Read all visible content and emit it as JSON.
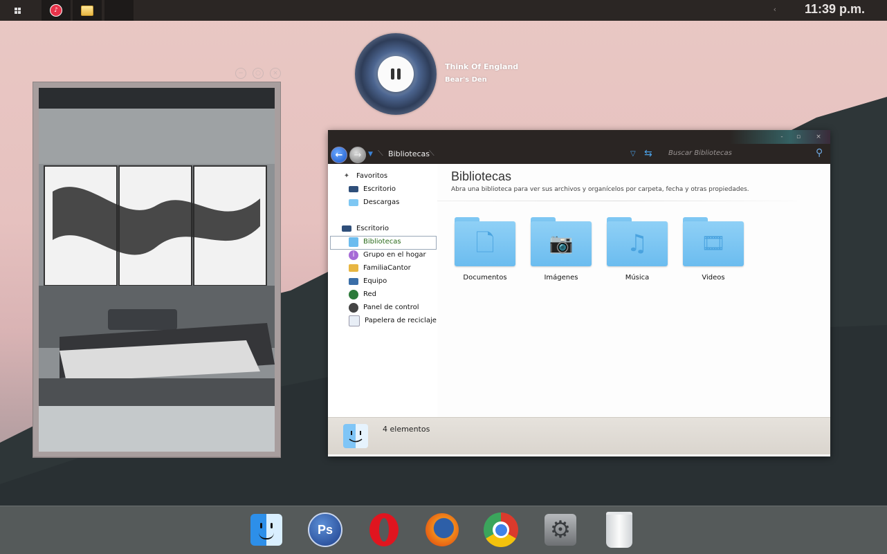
{
  "taskbar": {
    "clock": "11:39 p.m.",
    "tray_chevron": "‹",
    "buttons": [
      {
        "name": "start-button",
        "icon": "windows-icon"
      },
      {
        "name": "itunes-taskbar-button",
        "icon": "itunes-icon"
      },
      {
        "name": "explorer-taskbar-button",
        "icon": "folder-icon"
      }
    ]
  },
  "music": {
    "song": "Think Of England",
    "artist": "Bear's Den",
    "control_icon": "pause-icon"
  },
  "photo_widget": {
    "controls": [
      "−",
      "○",
      "×"
    ]
  },
  "explorer": {
    "window_controls": [
      "-",
      "▫",
      "×"
    ],
    "back_glyph": "←",
    "forward_glyph": "→",
    "breadcrumb": "Bibliotecas",
    "search_placeholder": "Buscar Bibliotecas",
    "sidebar": {
      "favorites": {
        "label": "Favoritos",
        "items": [
          "Escritorio",
          "Descargas"
        ]
      },
      "desktop": {
        "label": "Escritorio",
        "items": [
          "Bibliotecas",
          "Grupo en el hogar",
          "FamiliaCantor",
          "Equipo",
          "Red",
          "Panel de control",
          "Papelera de reciclaje"
        ]
      },
      "selected": "Bibliotecas"
    },
    "content": {
      "title": "Bibliotecas",
      "description": "Abra una biblioteca para ver sus archivos y organícelos por carpeta, fecha y otras propiedades.",
      "folders": [
        {
          "label": "Documentos",
          "icon": "document-icon",
          "glyph": "🗋"
        },
        {
          "label": "Imágenes",
          "icon": "camera-icon",
          "glyph": "📷"
        },
        {
          "label": "Música",
          "icon": "music-note-icon",
          "glyph": "♫"
        },
        {
          "label": "Videos",
          "icon": "film-icon",
          "glyph": "🎞"
        }
      ]
    },
    "status": "4 elementos"
  },
  "dock": {
    "items": [
      {
        "name": "finder",
        "icon": "finder-icon"
      },
      {
        "name": "photoshop",
        "icon": "photoshop-icon",
        "text": "Ps"
      },
      {
        "name": "opera",
        "icon": "opera-icon"
      },
      {
        "name": "firefox",
        "icon": "firefox-icon"
      },
      {
        "name": "chrome",
        "icon": "chrome-icon"
      },
      {
        "name": "system-preferences",
        "icon": "gear-icon"
      },
      {
        "name": "trash",
        "icon": "trash-icon"
      }
    ]
  }
}
